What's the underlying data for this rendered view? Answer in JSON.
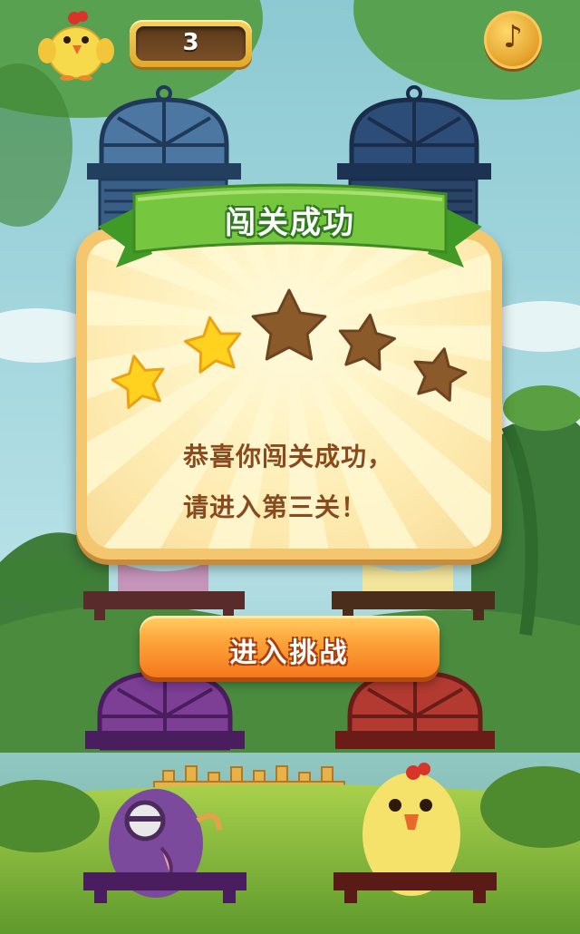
{
  "hud": {
    "score": "3",
    "music_icon": "music-note-icon",
    "avatar_icon": "chick-avatar-icon"
  },
  "dialog": {
    "title": "闯关成功",
    "message_line1": "恭喜你闯关成功，",
    "message_line2": "请进入第三关！",
    "stars_earned": 2,
    "stars_total": 5
  },
  "button": {
    "enter_label": "进入挑战"
  },
  "colors": {
    "ribbon_green": "#6cc23b",
    "button_orange": "#f4791c",
    "star_gold": "#ffd21f",
    "star_empty": "#8a5a2b",
    "text_brown": "#8a4a1b"
  }
}
